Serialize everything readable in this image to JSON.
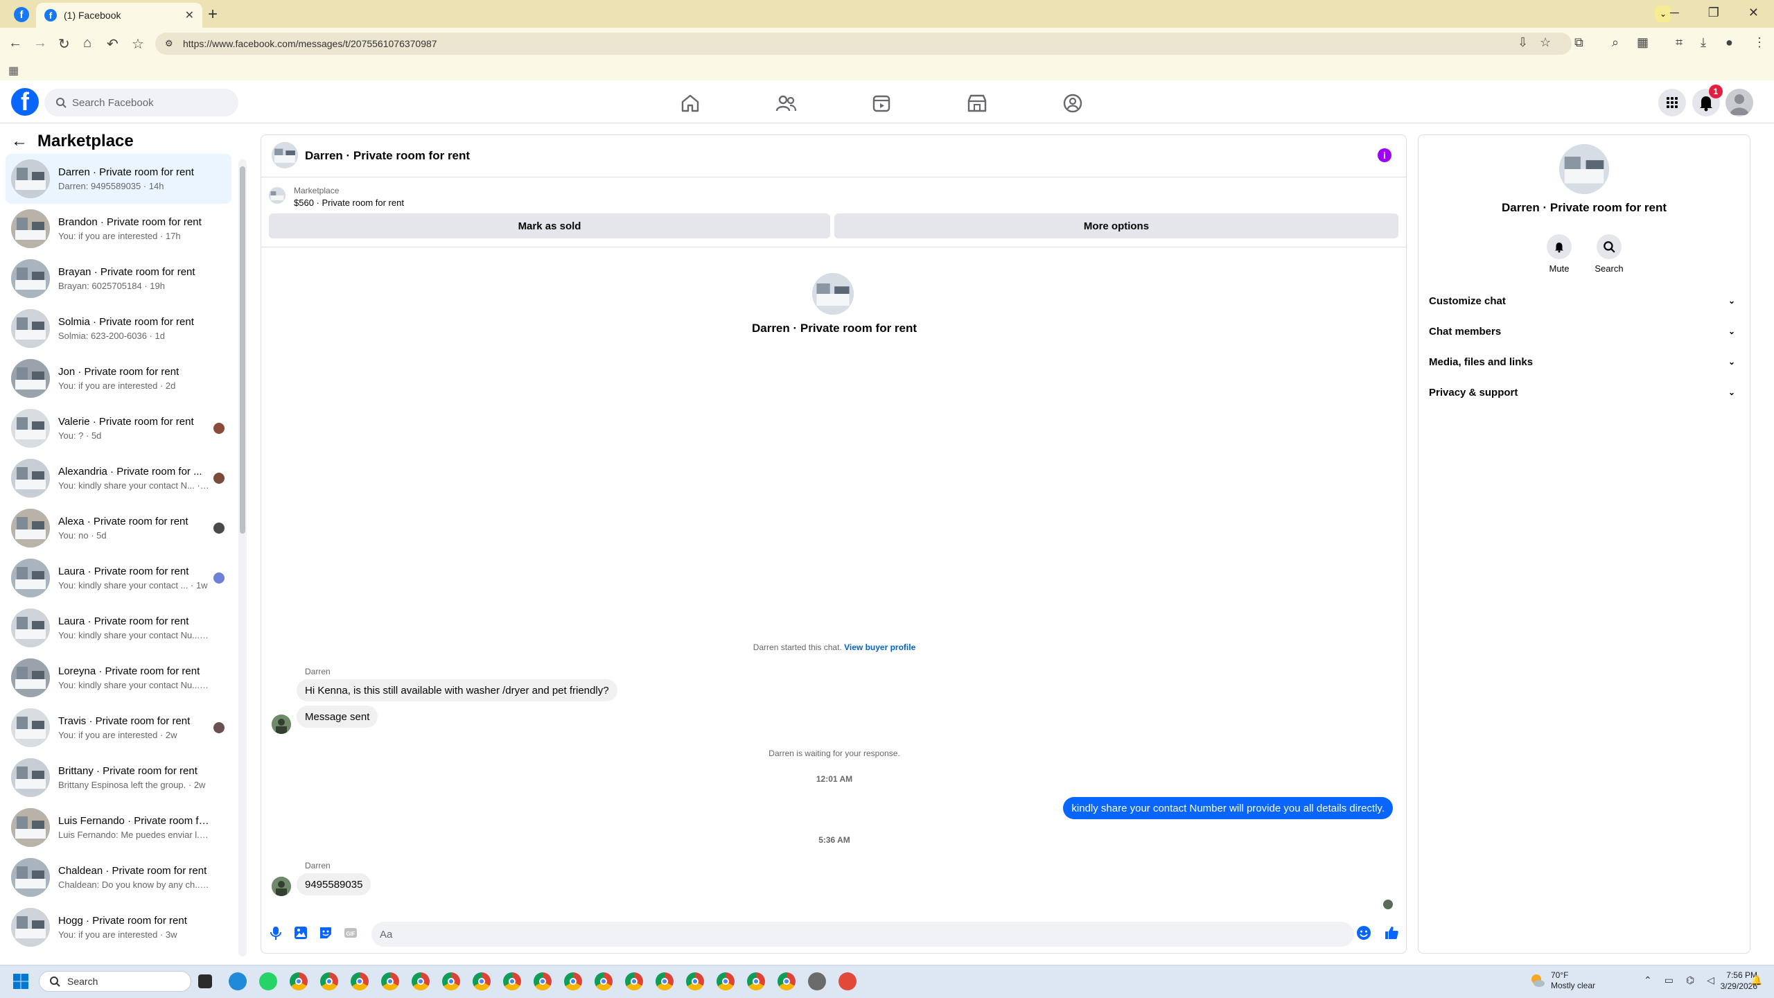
{
  "browser": {
    "tab_title": "(1) Facebook",
    "url": "https://www.facebook.com/messages/t/2075561076370987"
  },
  "facebook": {
    "search_placeholder": "Search Facebook",
    "notification_count": "1",
    "brand_color": "#0866ff"
  },
  "sidebar": {
    "title": "Marketplace",
    "conversations": [
      {
        "name": "Darren · Private room for rent",
        "preview": "Darren: 9495589035 · 14h"
      },
      {
        "name": "Brandon · Private room for rent",
        "preview": "You: if you are interested · 17h"
      },
      {
        "name": "Brayan · Private room for rent",
        "preview": "Brayan: 6025705184 · 19h"
      },
      {
        "name": "Solmia · Private room for rent",
        "preview": "Solmia: 623-200-6036 · 1d"
      },
      {
        "name": "Jon · Private room for rent",
        "preview": "You: if you are interested · 2d"
      },
      {
        "name": "Valerie · Private room for rent",
        "preview": "You: ? · 5d"
      },
      {
        "name": "Alexandria · Private room for ...",
        "preview": "You: kindly share your contact N... · 5d"
      },
      {
        "name": "Alexa · Private room for rent",
        "preview": "You: no · 5d"
      },
      {
        "name": "Laura · Private room for rent",
        "preview": "You: kindly share your contact ... · 1w"
      },
      {
        "name": "Laura · Private room for rent",
        "preview": "You: kindly share your contact Nu... · 1w"
      },
      {
        "name": "Loreyna · Private room for rent",
        "preview": "You: kindly share your contact Nu... · 1w"
      },
      {
        "name": "Travis · Private room for rent",
        "preview": "You: if you are interested · 2w"
      },
      {
        "name": "Brittany · Private room for rent",
        "preview": "Brittany Espinosa left the group. · 2w"
      },
      {
        "name": "Luis Fernando · Private room for...",
        "preview": "Luis Fernando: Me puedes enviar l... · 3w"
      },
      {
        "name": "Chaldean · Private room for rent",
        "preview": "Chaldean: Do you know by any ch... · 3w"
      },
      {
        "name": "Hogg · Private room for rent",
        "preview": "You: if you are interested · 3w"
      }
    ]
  },
  "chat": {
    "title": "Darren · Private room for rent",
    "marketplace_label": "Marketplace",
    "listing": "$560 · Private room for rent",
    "mark_sold": "Mark as sold",
    "more_options": "More options",
    "center_name": "Darren · Private room for rent",
    "started": "Darren started this chat.",
    "view_profile": "View buyer profile",
    "sender1": "Darren",
    "msg1": "Hi Kenna, is this still available with washer /dryer and pet friendly?",
    "msg2": "Message sent",
    "waiting": "Darren is waiting for your response.",
    "time1": "12:01 AM",
    "mine1": "kindly share your contact Number will provide you all details directly.",
    "time2": "5:36 AM",
    "sender2": "Darren",
    "msg3": "9495589035",
    "input_placeholder": "Aa"
  },
  "info_panel": {
    "name": "Darren · Private room for rent",
    "mute": "Mute",
    "search": "Search",
    "rows": [
      "Customize chat",
      "Chat members",
      "Media, files and links",
      "Privacy & support"
    ]
  },
  "taskbar": {
    "search": "Search",
    "weather_temp": "70°F",
    "weather_desc": "Mostly clear",
    "time": "7:56 PM",
    "date": "3/29/2026"
  }
}
